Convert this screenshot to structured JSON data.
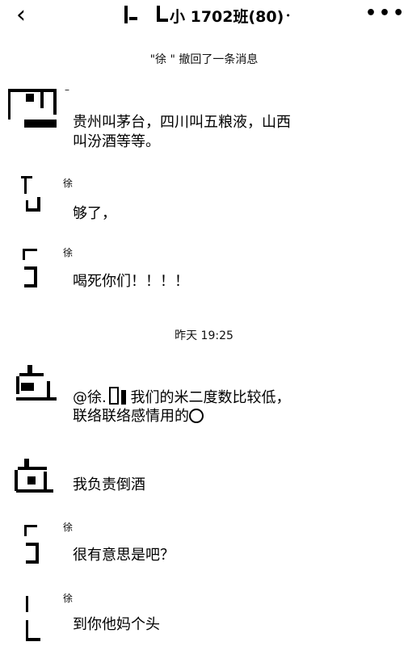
{
  "header": {
    "back_icon": "chevron-left-icon",
    "title": "小 1702班(80)",
    "title_badge": "🔔",
    "more_label": "•••"
  },
  "system": {
    "recall_notice": "\"徐      \" 撤回了一条消息",
    "timestamp": "昨天 19:25"
  },
  "messages": [
    {
      "sender": "–",
      "text": "贵州叫茅台，四川叫五粮液，山西\n叫汾酒等等。"
    },
    {
      "sender": "徐",
      "text": "够了，"
    },
    {
      "sender": "徐",
      "text": "喝死你们！！！！"
    },
    {
      "sender": "",
      "text_a": "@徐.",
      "text_b": " 我们的米二度数比较低，",
      "text_c": "联络联络感情用的",
      "emoji": "laughing-emoji-icon"
    },
    {
      "sender": "",
      "text": "我负责倒酒"
    },
    {
      "sender": "徐",
      "text": "很有意思是吧？"
    },
    {
      "sender": "徐",
      "text": "到你他妈个头"
    }
  ]
}
